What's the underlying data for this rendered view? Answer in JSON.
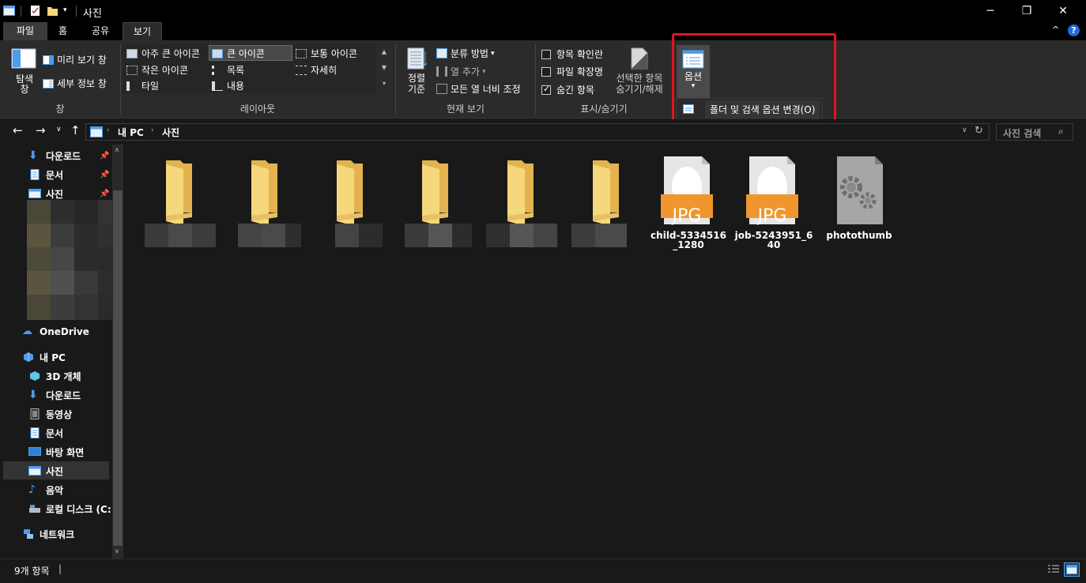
{
  "window": {
    "title": "사진",
    "minimize_glyph": "─",
    "restore_glyph": "❐",
    "close_glyph": "✕"
  },
  "tabs": [
    {
      "label": "파일"
    },
    {
      "label": "홈"
    },
    {
      "label": "공유"
    },
    {
      "label": "보기"
    }
  ],
  "ribbon": {
    "pane": {
      "navigation_pane": "탐색\n창",
      "preview_pane": "미리 보기 창",
      "details_pane": "세부 정보 창",
      "group_label": "창"
    },
    "layout": {
      "items": [
        "아주 큰 아이콘",
        "큰 아이콘",
        "보통 아이콘",
        "작은 아이콘",
        "목록",
        "자세히",
        "타일",
        "내용"
      ],
      "selected": "큰 아이콘",
      "group_label": "레이아웃"
    },
    "current_view": {
      "sort_by": "정렬\n기준",
      "group_by": "분류 방법",
      "add_columns": "열 추가",
      "size_all_columns": "모든 열 너비 조정",
      "group_label": "현재 보기"
    },
    "show_hide": {
      "item_check_boxes": "항목 확인란",
      "file_name_extensions": "파일 확장명",
      "hidden_items": "숨긴 항목",
      "hide_selected": "선택한 항목\n숨기기/해제",
      "group_label": "표시/숨기기",
      "checked": {
        "item_check_boxes": false,
        "file_name_extensions": false,
        "hidden_items": true
      }
    },
    "options": {
      "label": "옵션",
      "menu_item": "폴더 및 검색 옵션 변경(O)"
    }
  },
  "address": {
    "path": [
      "내 PC",
      "사진"
    ],
    "search_placeholder": "사진 검색"
  },
  "nav": {
    "quick_access": [
      {
        "label": "다운로드",
        "icon": "download-icon"
      },
      {
        "label": "문서",
        "icon": "document-icon"
      },
      {
        "label": "사진",
        "icon": "pictures-icon"
      }
    ],
    "onedrive": "OneDrive",
    "this_pc": "내 PC",
    "pc_items": [
      {
        "label": "3D 개체",
        "icon": "cube-icon"
      },
      {
        "label": "다운로드",
        "icon": "download-icon"
      },
      {
        "label": "동영상",
        "icon": "video-icon"
      },
      {
        "label": "문서",
        "icon": "document-icon"
      },
      {
        "label": "바탕 화면",
        "icon": "desktop-icon"
      },
      {
        "label": "사진",
        "icon": "pictures-icon"
      },
      {
        "label": "음악",
        "icon": "music-icon"
      },
      {
        "label": "로컬 디스크 (C:",
        "icon": "drive-icon"
      }
    ],
    "network": "네트워크"
  },
  "files": {
    "folders_count": 6,
    "images": [
      {
        "name": "child-5334516_1280",
        "badge": "JPG"
      },
      {
        "name": "job-5243951_640",
        "badge": "JPG"
      }
    ],
    "other": [
      {
        "name": "photothumb",
        "icon": "settings-file-icon"
      }
    ]
  },
  "status": {
    "item_count": "9개 항목"
  },
  "colors": {
    "highlight": "#e0141e",
    "folder": "#f6d77b",
    "jpg_badge": "#f0962c",
    "accent_blue": "#4c9ded"
  }
}
